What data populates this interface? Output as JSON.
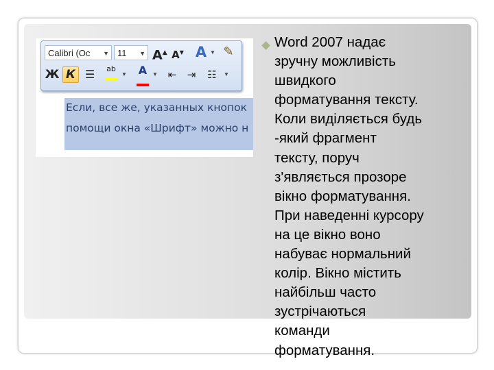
{
  "screenshot": {
    "toolbar": {
      "font_name": "Calibri (Ос",
      "font_size": "11",
      "grow_font_icon": "A",
      "shrink_font_icon": "A",
      "styles_icon": "A",
      "bold_label": "Ж",
      "italic_label": "К",
      "highlight_label": "ab",
      "font_color_label": "A"
    },
    "selected_text_lines": [
      "Если, все же, указанных кнопок",
      "помощи окна «Шрифт» можно н"
    ]
  },
  "bullet_text": "Word 2007 надає\nзручну можливість\nшвидкого\nформатування тексту.\nКоли виділяється будь\n-який фрагмент\nтексту, поруч\nз'являється прозоре\nвікно форматування.\nПри наведенні курсору\nна це вікно воно\nнабуває нормальний\nколір. Вікно містить\nнайбільш часто\nзустрічаються\nкоманди\nформатування.",
  "colors": {
    "bullet": "#a9b88a",
    "selection": "#b7c8e6",
    "highlight": "#ffff00",
    "font_color": "#ff0000"
  }
}
